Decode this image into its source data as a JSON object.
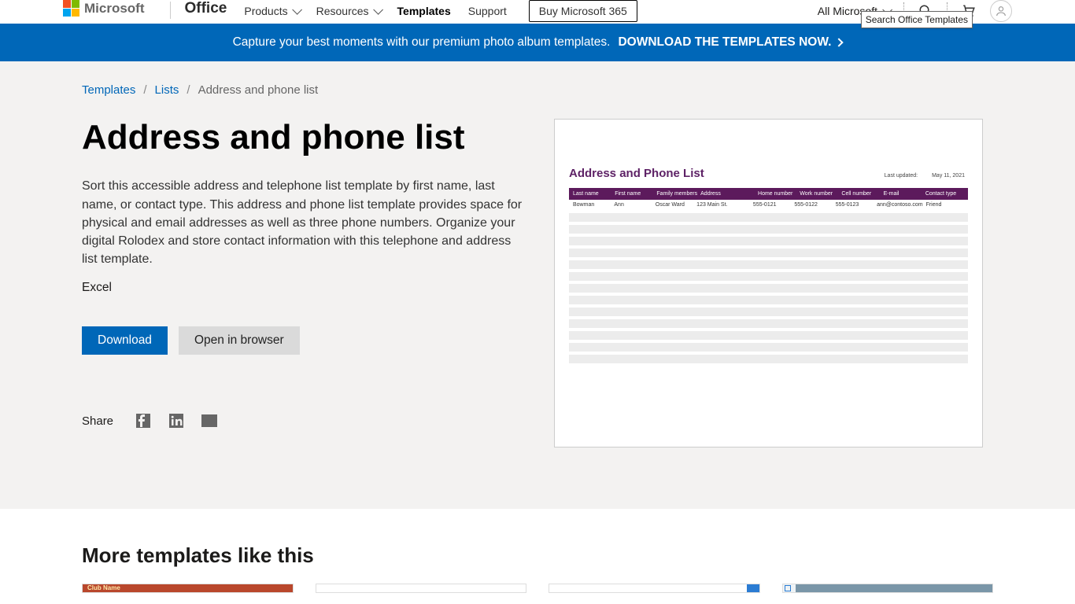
{
  "nav": {
    "ms_label": "Microsoft",
    "office_label": "Office",
    "links": {
      "products": "Products",
      "resources": "Resources",
      "templates": "Templates",
      "support": "Support"
    },
    "buy_label": "Buy Microsoft 365",
    "all_ms": "All Microsoft",
    "search_tooltip": "Search Office Templates"
  },
  "promo": {
    "text": "Capture your best moments with our premium photo album templates.",
    "cta": "DOWNLOAD THE TEMPLATES NOW."
  },
  "breadcrumb": {
    "root": "Templates",
    "parent": "Lists",
    "current": "Address and phone list"
  },
  "page": {
    "title": "Address and phone list",
    "description": "Sort this accessible address and telephone list template by first name, last name, or contact type. This address and phone list template provides space for physical and email addresses as well as three phone numbers. Organize your digital Rolodex and store contact information with this telephone and address list template.",
    "app": "Excel",
    "download": "Download",
    "open": "Open in browser",
    "share": "Share"
  },
  "preview": {
    "title": "Address and Phone List",
    "updated_label": "Last updated:",
    "updated_value": "May 11, 2021",
    "headers": [
      "Last name",
      "First name",
      "Family members",
      "Address",
      "Home number",
      "Work number",
      "Cell number",
      "E-mail",
      "Contact type"
    ],
    "row": [
      "Bowman",
      "Ann",
      "Oscar Ward",
      "123 Main St.",
      "555-0121",
      "555-0122",
      "555-0123",
      "ann@contoso.com",
      "Friend"
    ]
  },
  "more": {
    "heading": "More templates like this",
    "card1_label": "Club Name"
  }
}
